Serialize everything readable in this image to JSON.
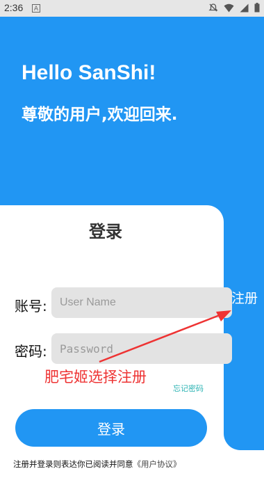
{
  "status_bar": {
    "time": "2:36",
    "left_badge": "A",
    "icons": [
      "mute-icon",
      "wifi-icon",
      "signal-icon",
      "battery-icon"
    ]
  },
  "hero": {
    "title": "Hello SanShi!",
    "subtitle": "尊敬的用户,欢迎回来."
  },
  "side_panel": {
    "register_label": "注册"
  },
  "login_card": {
    "title": "登录",
    "account_label": "账号:",
    "username_placeholder": "User Name",
    "password_label": "密码:",
    "password_placeholder": "Password",
    "forgot_password": "忘记密码",
    "login_button": "登录",
    "agreement_text": "注册并登录则表达你已阅读并同意",
    "agreement_link": "《用户协议》"
  },
  "annotation": {
    "text": "肥宅姬选择注册"
  },
  "colors": {
    "primary": "#2196f3",
    "input_bg": "#e3e3e3",
    "forgot_link": "#2bb3b3",
    "annotation": "#ee3333"
  }
}
